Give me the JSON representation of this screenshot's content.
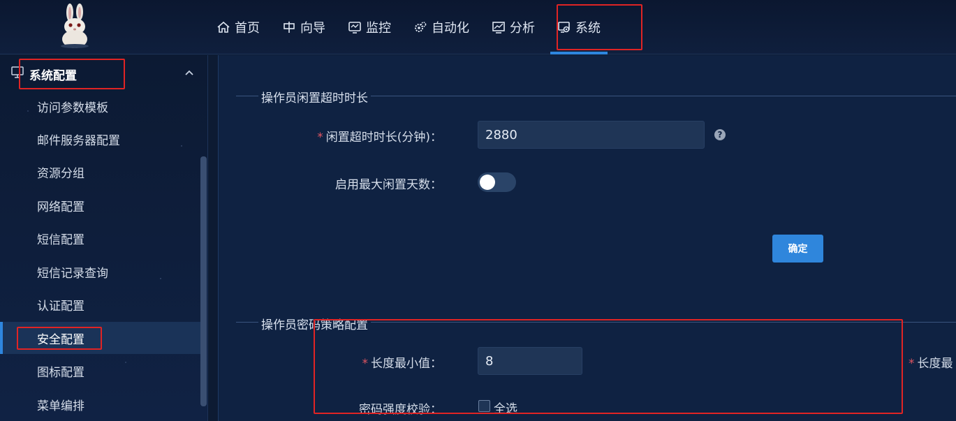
{
  "nav": {
    "items": [
      {
        "label": "首页",
        "icon": "home-icon"
      },
      {
        "label": "向导",
        "icon": "guide-icon"
      },
      {
        "label": "监控",
        "icon": "monitor-icon"
      },
      {
        "label": "自动化",
        "icon": "gears-icon"
      },
      {
        "label": "分析",
        "icon": "chart-monitor-icon"
      },
      {
        "label": "系统",
        "icon": "system-settings-icon"
      }
    ],
    "active": "系统"
  },
  "sidebar": {
    "header": "系统配置",
    "items": [
      {
        "label": "访问参数模板"
      },
      {
        "label": "邮件服务器配置"
      },
      {
        "label": "资源分组"
      },
      {
        "label": "网络配置"
      },
      {
        "label": "短信配置"
      },
      {
        "label": "短信记录查询"
      },
      {
        "label": "认证配置"
      },
      {
        "label": "安全配置"
      },
      {
        "label": "图标配置"
      },
      {
        "label": "菜单编排"
      }
    ],
    "active": "安全配置"
  },
  "idle": {
    "section_title": "操作员闲置超时时长",
    "timeout_label": "闲置超时时长(分钟)：",
    "timeout_value": "2880",
    "max_days_label": "启用最大闲置天数：",
    "max_days_enabled": false,
    "confirm_label": "确定"
  },
  "password": {
    "section_title": "操作员密码策略配置",
    "min_length_label": "长度最小值：",
    "min_length_value": "8",
    "max_length_label_partial": "长度最",
    "strength_label": "密码强度校验：",
    "select_all_label": "全选",
    "select_all_checked": false
  },
  "colors": {
    "accent": "#2e86de",
    "highlight_box": "#e02424",
    "required_star": "#e05561"
  }
}
